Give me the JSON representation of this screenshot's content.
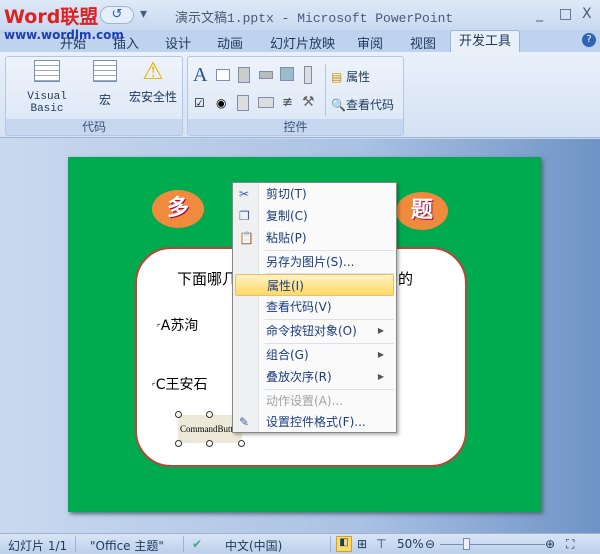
{
  "window": {
    "title": "演示文稿1.pptx - Microsoft PowerPoint",
    "logo_text": "Word联盟",
    "logo_url": "www.wordlm.com",
    "minimize": "_",
    "maximize": "□",
    "close": "X",
    "undo": "↺",
    "qat_more": "₹"
  },
  "tabs": [
    {
      "label": "开始"
    },
    {
      "label": "插入"
    },
    {
      "label": "设计"
    },
    {
      "label": "动画"
    },
    {
      "label": "幻灯片放映"
    },
    {
      "label": "审阅"
    },
    {
      "label": "视图"
    },
    {
      "label": "开发工具",
      "active": true
    }
  ],
  "help": "?",
  "ribbon": {
    "code_group": {
      "label": "代码",
      "buttons": [
        {
          "label": "Visual Basic",
          "icon": "visual-basic-icon"
        },
        {
          "label": "宏",
          "icon": "macro-icon"
        },
        {
          "label": "宏安全性",
          "icon": "warning-icon"
        }
      ]
    },
    "controls_group": {
      "label": "控件",
      "properties": "属性",
      "view_code": "查看代码",
      "label_glyph": "A"
    }
  },
  "slide": {
    "left_badge": "多",
    "right_badge": "题",
    "question_start": "下面哪几",
    "question_end": "的",
    "option_a": "A苏洵",
    "option_c": "C王安石",
    "command_button": "CommandButton1"
  },
  "context_menu": {
    "items": [
      {
        "label": "剪切(T)",
        "icon": "cut-icon",
        "glyph": "✂"
      },
      {
        "label": "复制(C)",
        "icon": "copy-icon",
        "glyph": "❐"
      },
      {
        "label": "粘贴(P)",
        "icon": "paste-icon",
        "glyph": "📋"
      },
      {
        "label": "另存为图片(S)...",
        "separator_before": true
      },
      {
        "label": "属性(I)",
        "highlighted": true,
        "separator_before": true
      },
      {
        "label": "查看代码(V)"
      },
      {
        "label": "命令按钮对象(O)",
        "submenu": true,
        "separator_before": true
      },
      {
        "label": "组合(G)",
        "submenu": true,
        "separator_before": true
      },
      {
        "label": "叠放次序(R)",
        "submenu": true
      },
      {
        "label": "动作设置(A)...",
        "disabled": true,
        "separator_before": true
      },
      {
        "label": "设置控件格式(F)...",
        "icon": "format-control-icon",
        "glyph": "✎"
      }
    ]
  },
  "status": {
    "slide": "幻灯片 1/1",
    "theme": "\"Office 主题\"",
    "language": "中文(中国)",
    "zoom": "50%",
    "zoom_percent": 50
  },
  "colors": {
    "slide_bg": "#00ab50",
    "badge": "#f08a3c",
    "highlight": "#ffd866"
  }
}
